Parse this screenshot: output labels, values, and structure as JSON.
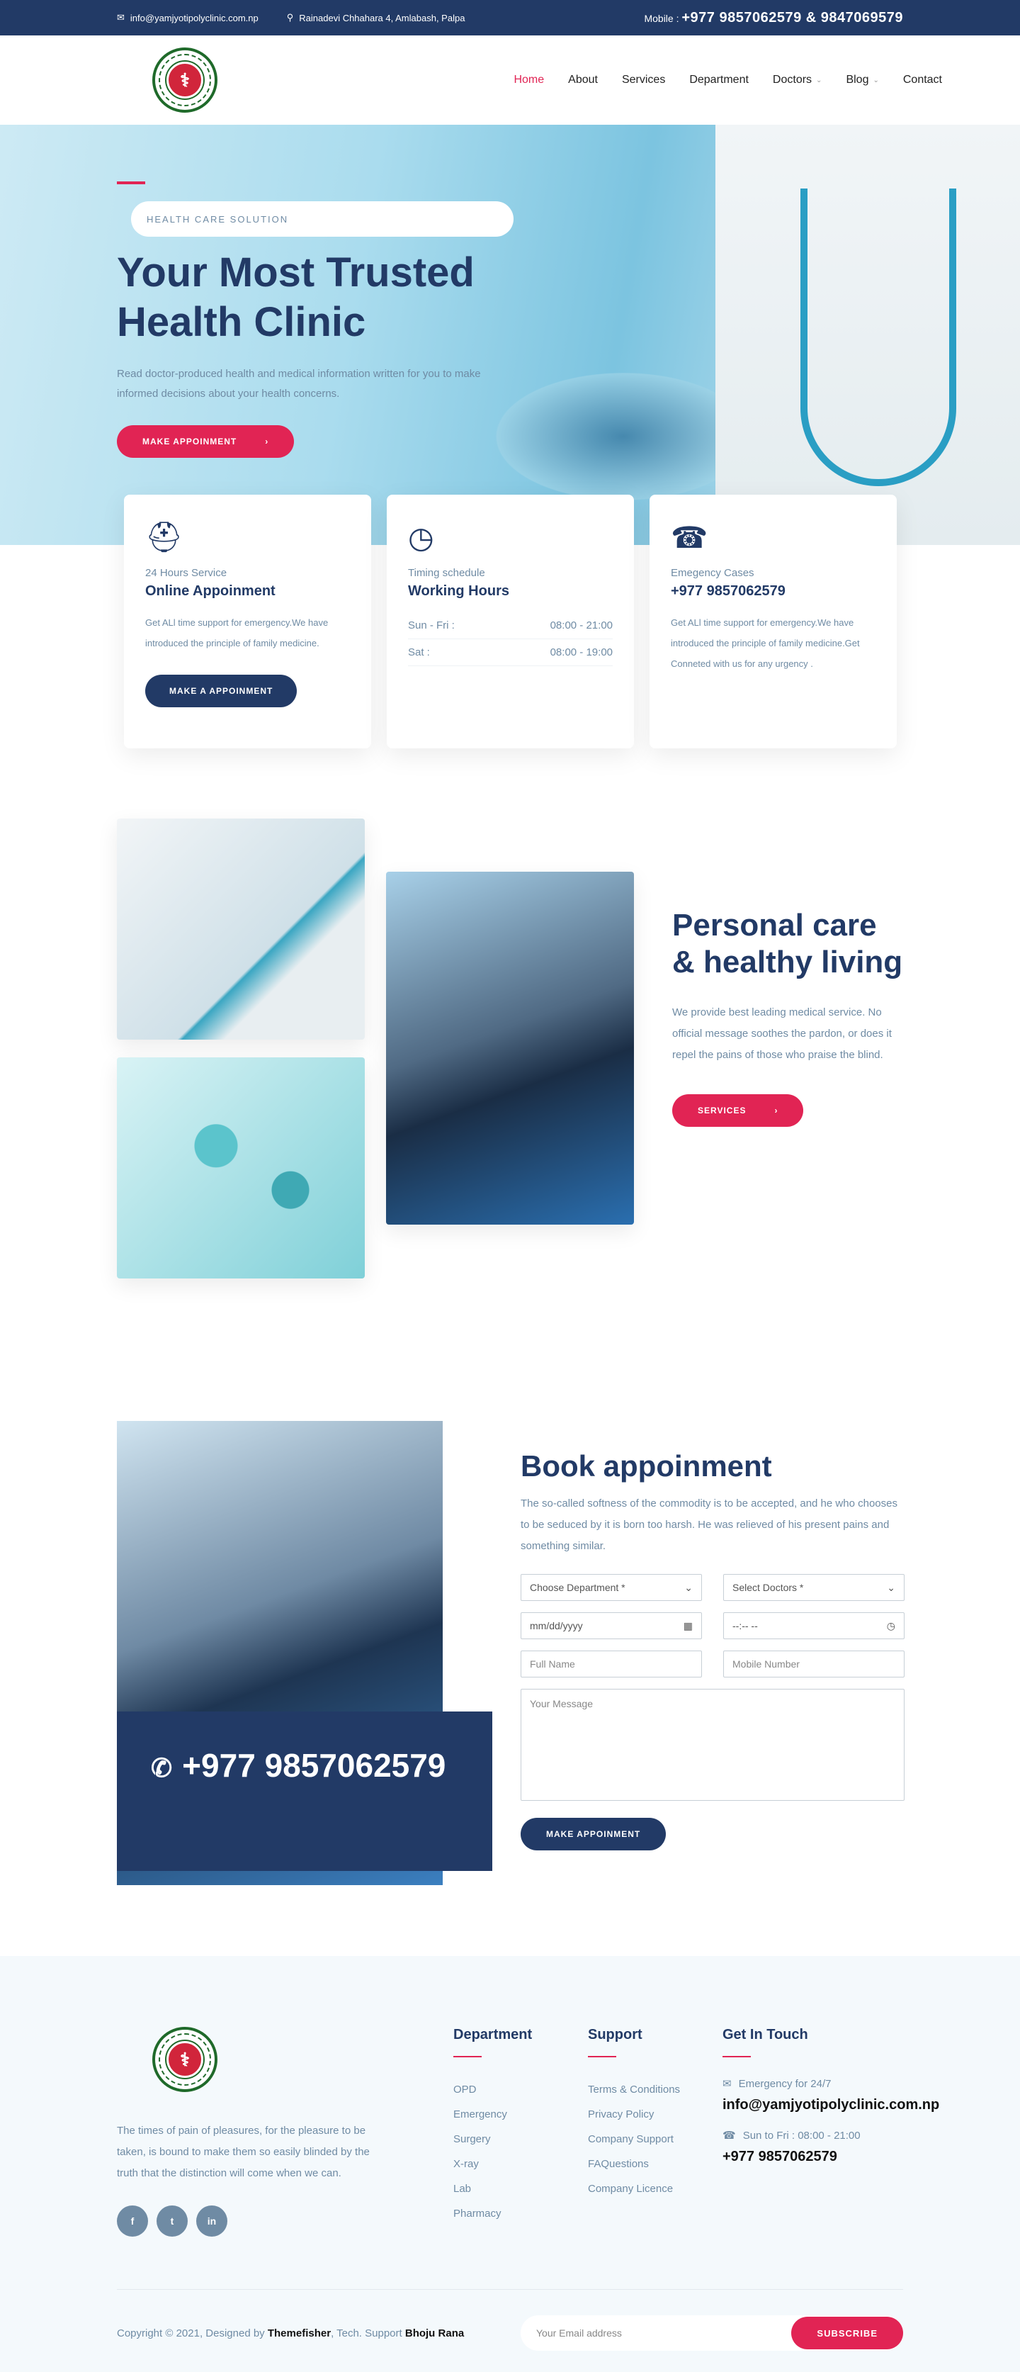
{
  "topbar": {
    "email": "info@yamjyotipolyclinic.com.np",
    "address": "Rainadevi Chhahara 4, Amlabash, Palpa",
    "mobile_label": "Mobile :",
    "mobile_numbers": "+977 9857062579 & 9847069579"
  },
  "nav": {
    "items": [
      "Home",
      "About",
      "Services",
      "Department",
      "Doctors",
      "Blog",
      "Contact"
    ]
  },
  "hero": {
    "subtitle": "HEALTH CARE SOLUTION",
    "title_line1": "Your Most Trusted",
    "title_line2": "Health Clinic",
    "desc": "Read doctor-produced health and medical information written for you to make informed decisions about your health concerns.",
    "button": "MAKE APPOINMENT"
  },
  "cards": [
    {
      "label": "24 Hours Service",
      "title": "Online Appoinment",
      "desc": "Get ALl time support for emergency.We have introduced the principle of family medicine.",
      "button": "MAKE A APPOINMENT"
    },
    {
      "label": "Timing schedule",
      "title": "Working Hours",
      "rows": [
        {
          "day": "Sun - Fri :",
          "time": "08:00 - 21:00"
        },
        {
          "day": "Sat :",
          "time": "08:00 - 19:00"
        }
      ]
    },
    {
      "label": "Emegency Cases",
      "title": "+977 9857062579",
      "desc": "Get ALl time support for emergency.We have introduced the principle of family medicine.Get Conneted with us for any urgency ."
    }
  ],
  "about": {
    "title": "Personal care & healthy living",
    "desc": "We provide best leading medical service. No official message soothes the pardon, or does it repel the pains of those who praise the blind.",
    "button": "SERVICES"
  },
  "book": {
    "phone": "+977 9857062579",
    "title": "Book appoinment",
    "desc": "The so-called softness of the commodity is to be accepted, and he who chooses to be seduced by it is born too harsh. He was relieved of his present pains and something similar.",
    "dept": "Choose Department *",
    "doctor": "Select Doctors *",
    "date": "mm/dd/yyyy",
    "time": "--:-- --",
    "name": "Full Name",
    "mobile": "Mobile Number",
    "message": "Your Message",
    "button": "MAKE APPOINMENT"
  },
  "footer": {
    "about": "The times of pain of pleasures, for the pleasure to be taken, is bound to make them so easily blinded by the truth that the distinction will come when we can.",
    "social": [
      "f",
      "t",
      "in"
    ],
    "dept_title": "Department",
    "dept": [
      "OPD",
      "Emergency",
      "Surgery",
      "X-ray",
      "Lab",
      "Pharmacy"
    ],
    "support_title": "Support",
    "support": [
      "Terms & Conditions",
      "Privacy Policy",
      "Company Support",
      "FAQuestions",
      "Company Licence"
    ],
    "touch_title": "Get In Touch",
    "emergency_label": "Emergency for 24/7",
    "email": "info@yamjyotipolyclinic.com.np",
    "hours_label": "Sun to Fri : 08:00 - 21:00",
    "phone": "+977 9857062579",
    "copyright_pre": "Copyright © 2021, Designed by",
    "designer": "Themefisher",
    "support_pre": ", Tech. Support",
    "supporter": "Bhoju Rana",
    "email_placeholder": "Your Email address",
    "subscribe": "SUBSCRIBE"
  }
}
